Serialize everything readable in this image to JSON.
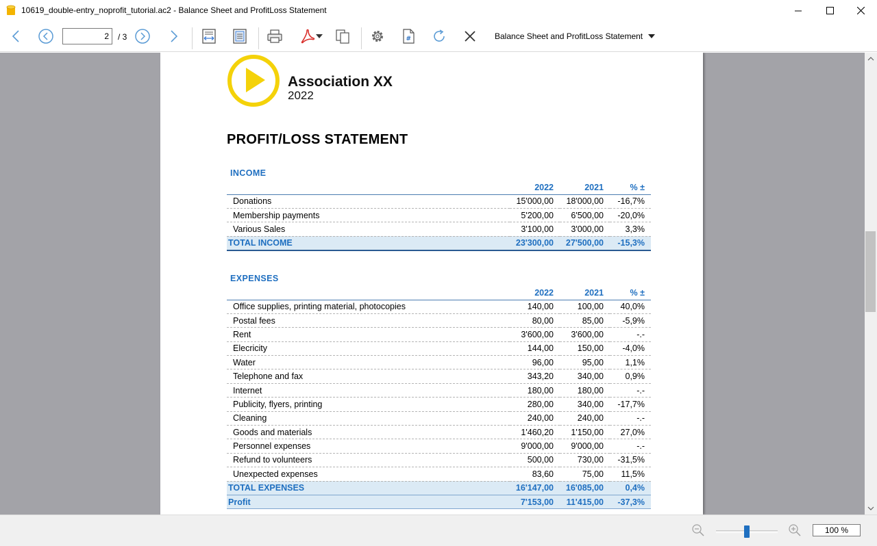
{
  "window": {
    "title": "10619_double-entry_noprofit_tutorial.ac2 - Balance Sheet and ProfitLoss Statement"
  },
  "toolbar": {
    "current_page": "2",
    "page_total": "/ 3",
    "report_name": "Balance Sheet and ProfitLoss Statement"
  },
  "status": {
    "zoom": "100 %",
    "zoom_fraction": 0.5
  },
  "report": {
    "org_name": "Association XX",
    "org_year": "2022",
    "title": "PROFIT/LOSS STATEMENT",
    "income": {
      "heading": "INCOME",
      "columns": [
        "2022",
        "2021",
        "% ±"
      ],
      "rows": [
        {
          "label": "Donations",
          "y2022": "15'000,00",
          "y2021": "18'000,00",
          "pct": "-16,7%"
        },
        {
          "label": "Membership payments",
          "y2022": "5'200,00",
          "y2021": "6'500,00",
          "pct": "-20,0%"
        },
        {
          "label": "Various Sales",
          "y2022": "3'100,00",
          "y2021": "3'000,00",
          "pct": "3,3%"
        }
      ],
      "total": {
        "label": "TOTAL INCOME",
        "y2022": "23'300,00",
        "y2021": "27'500,00",
        "pct": "-15,3%"
      }
    },
    "expenses": {
      "heading": "EXPENSES",
      "columns": [
        "2022",
        "2021",
        "% ±"
      ],
      "rows": [
        {
          "label": "Office supplies, printing material, photocopies",
          "y2022": "140,00",
          "y2021": "100,00",
          "pct": "40,0%"
        },
        {
          "label": "Postal fees",
          "y2022": "80,00",
          "y2021": "85,00",
          "pct": "-5,9%"
        },
        {
          "label": "Rent",
          "y2022": "3'600,00",
          "y2021": "3'600,00",
          "pct": "-.-"
        },
        {
          "label": "Elecricity",
          "y2022": "144,00",
          "y2021": "150,00",
          "pct": "-4,0%"
        },
        {
          "label": "Water",
          "y2022": "96,00",
          "y2021": "95,00",
          "pct": "1,1%"
        },
        {
          "label": "Telephone and fax",
          "y2022": "343,20",
          "y2021": "340,00",
          "pct": "0,9%"
        },
        {
          "label": "Internet",
          "y2022": "180,00",
          "y2021": "180,00",
          "pct": "-.-"
        },
        {
          "label": "Publicity, flyers, printing",
          "y2022": "280,00",
          "y2021": "340,00",
          "pct": "-17,7%"
        },
        {
          "label": "Cleaning",
          "y2022": "240,00",
          "y2021": "240,00",
          "pct": "-.-"
        },
        {
          "label": "Goods and materials",
          "y2022": "1'460,20",
          "y2021": "1'150,00",
          "pct": "27,0%"
        },
        {
          "label": "Personnel expenses",
          "y2022": "9'000,00",
          "y2021": "9'000,00",
          "pct": "-.-"
        },
        {
          "label": "Refund to volunteers",
          "y2022": "500,00",
          "y2021": "730,00",
          "pct": "-31,5%"
        },
        {
          "label": "Unexpected expenses",
          "y2022": "83,60",
          "y2021": "75,00",
          "pct": "11,5%"
        }
      ],
      "total": {
        "label": "TOTAL EXPENSES",
        "y2022": "16'147,00",
        "y2021": "16'085,00",
        "pct": "0,4%"
      },
      "profit": {
        "label": "Profit",
        "y2022": "7'153,00",
        "y2021": "11'415,00",
        "pct": "-37,3%"
      }
    }
  },
  "colors": {
    "accent_blue": "#1f6fc0",
    "logo_yellow": "#f4d20a",
    "total_row_bg": "#dbeaf5"
  }
}
